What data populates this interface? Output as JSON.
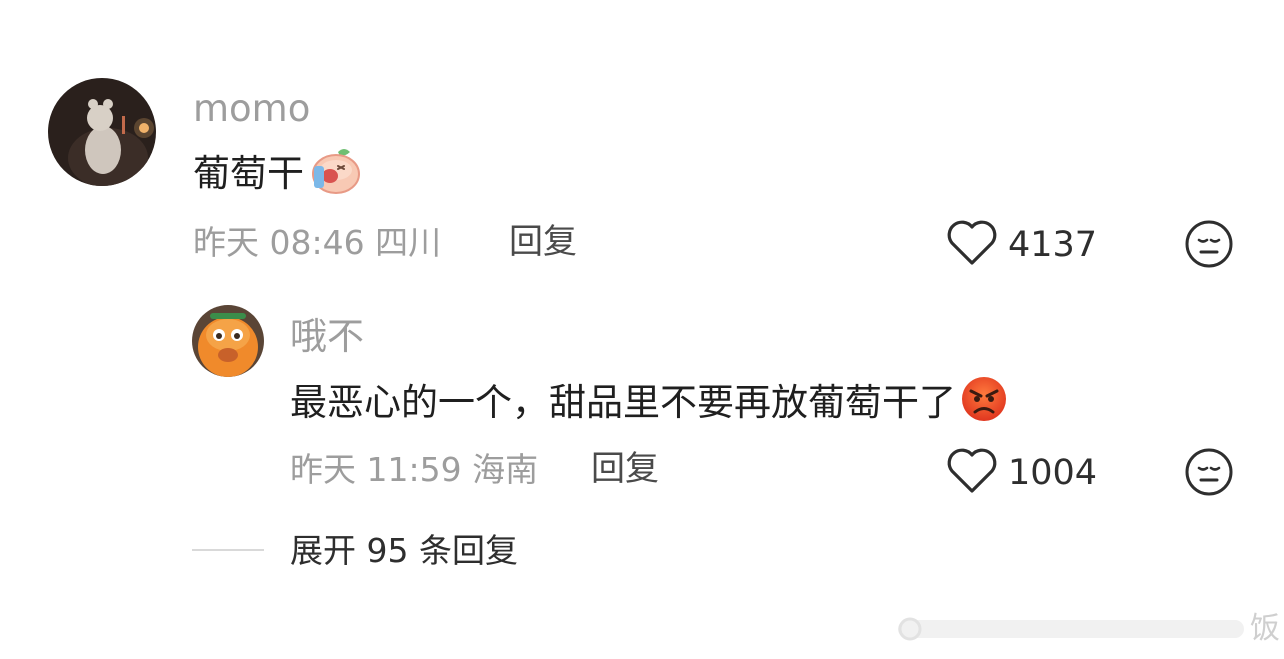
{
  "comments": [
    {
      "username": "momo",
      "text": "葡萄干",
      "emoji": "crying-peach-emoji",
      "time": "昨天 08:46",
      "location": "四川",
      "reply_label": "回复",
      "likes": "4137"
    }
  ],
  "reply": {
    "username": "哦不",
    "text": "最恶心的一个，甜品里不要再放葡萄干了",
    "emoji": "angry-face-emoji",
    "time": "昨天 11:59",
    "location": "海南",
    "reply_label": "回复",
    "likes": "1004"
  },
  "expand_replies_label": "展开 95 条回复",
  "watermark": "饭",
  "colors": {
    "muted_text": "#9d9d9d",
    "primary_text": "#1f1f1f",
    "action_text": "#4a4a4a",
    "divider": "#d9d9d9"
  }
}
